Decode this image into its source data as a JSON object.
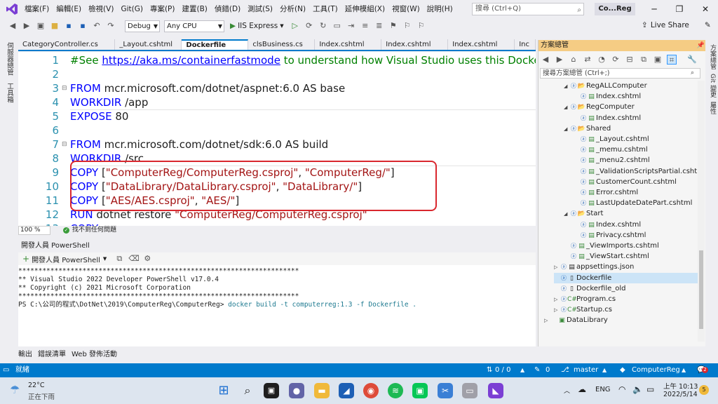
{
  "menubar": {
    "items": [
      "檔案(F)",
      "編輯(E)",
      "檢視(V)",
      "Git(G)",
      "專案(P)",
      "建置(B)",
      "偵錯(D)",
      "測試(S)",
      "分析(N)",
      "工具(T)",
      "延伸模組(X)",
      "視窗(W)",
      "說明(H)"
    ],
    "search_placeholder": "搜尋 (Ctrl+Q)",
    "solution_name": "Co...Reg"
  },
  "toolbar": {
    "config": "Debug",
    "platform": "Any CPU",
    "run_label": "IIS Express",
    "live_share": "Live Share"
  },
  "left_strip": {
    "server_explorer": "伺服器總管",
    "toolbox": "工具箱"
  },
  "doc_tabs": [
    "CategoryController.cs",
    "_Layout.cshtml",
    "Dockerfile",
    "clsBusiness.cs",
    "Index.cshtml",
    "Index.cshtml",
    "Index.cshtml",
    "Inc"
  ],
  "editor": {
    "lines": [
      {
        "n": "1",
        "kw": "",
        "link": "https://aka.ms/containerfastmode",
        "comment_pre": "#See ",
        "comment_post": " to understand how Visual Studio uses this Dockerfile"
      },
      {
        "n": "2"
      },
      {
        "n": "3",
        "kw": "FROM",
        "rest": " mcr.microsoft.com/dotnet/aspnet:6.0 AS base"
      },
      {
        "n": "4",
        "kw": "WORKDIR",
        "rest": " /app"
      },
      {
        "n": "5",
        "kw": "EXPOSE",
        "rest": " 80"
      },
      {
        "n": "6"
      },
      {
        "n": "7",
        "kw": "FROM",
        "rest": " mcr.microsoft.com/dotnet/sdk:6.0 AS build"
      },
      {
        "n": "8",
        "kw": "WORKDIR",
        "rest": " /src"
      },
      {
        "n": "9",
        "kw": "COPY",
        "bracket_open": " [",
        "s1": "\"ComputerReg/ComputerReg.csproj\"",
        "sep": ", ",
        "s2": "\"ComputerReg/\"",
        "bracket_close": "]"
      },
      {
        "n": "10",
        "kw": "COPY",
        "bracket_open": " [",
        "s1": "\"DataLibrary/DataLibrary.csproj\"",
        "sep": ", ",
        "s2": "\"DataLibrary/\"",
        "bracket_close": "]"
      },
      {
        "n": "11",
        "kw": "COPY",
        "bracket_open": " [",
        "s1": "\"AES/AES.csproj\"",
        "sep": ", ",
        "s2": "\"AES/\"",
        "bracket_close": "]"
      },
      {
        "n": "12",
        "kw": "RUN",
        "rest": " dotnet restore ",
        "s1": "\"ComputerReg/ComputerReg.csproj\""
      },
      {
        "n": "13",
        "kw": "COPY",
        "rest": ""
      }
    ],
    "zoom": "100 %",
    "issues": "找不到任何問題"
  },
  "powershell": {
    "title": "開發人員 PowerShell",
    "toolbar_label": "開發人員 PowerShell",
    "stars": "**********************************************************************",
    "line1": "** Visual Studio 2022 Developer PowerShell v17.0.4",
    "line2": "** Copyright (c) 2021 Microsoft Corporation",
    "prompt": "PS C:\\公司的程式\\DotNet\\2019\\ComputerReg\\ComputerReg> ",
    "command": "docker build -t computerreg:1.3 -f Dockerfile ."
  },
  "bottom_tabs": [
    "輸出",
    "錯誤清單",
    "Web 發佈活動"
  ],
  "solution_explorer": {
    "title": "方案總管",
    "search_placeholder": "搜尋方案總管 (Ctrl+;)",
    "nodes": [
      {
        "label": "RegALLComputer",
        "type": "folder",
        "expanded": true,
        "depth": 2
      },
      {
        "label": "Index.cshtml",
        "type": "cshtml",
        "depth": 3
      },
      {
        "label": "RegComputer",
        "type": "folder",
        "expanded": true,
        "depth": 2
      },
      {
        "label": "Index.cshtml",
        "type": "cshtml",
        "depth": 3
      },
      {
        "label": "Shared",
        "type": "folder",
        "expanded": true,
        "depth": 2
      },
      {
        "label": "_Layout.cshtml",
        "type": "cshtml",
        "depth": 3
      },
      {
        "label": "_memu.cshtml",
        "type": "cshtml",
        "depth": 3
      },
      {
        "label": "_menu2.cshtml",
        "type": "cshtml",
        "depth": 3
      },
      {
        "label": "_ValidationScriptsPartial.cshtm",
        "type": "cshtml",
        "depth": 3
      },
      {
        "label": "CustomerCount.cshtml",
        "type": "cshtml",
        "depth": 3
      },
      {
        "label": "Error.cshtml",
        "type": "cshtml",
        "depth": 3
      },
      {
        "label": "LastUpdateDatePart.cshtml",
        "type": "cshtml",
        "depth": 3
      },
      {
        "label": "Start",
        "type": "folder",
        "expanded": true,
        "depth": 2
      },
      {
        "label": "Index.cshtml",
        "type": "cshtml",
        "depth": 3
      },
      {
        "label": "Privacy.cshtml",
        "type": "cshtml",
        "depth": 3
      },
      {
        "label": "_ViewImports.cshtml",
        "type": "cshtml",
        "depth": 2
      },
      {
        "label": "_ViewStart.cshtml",
        "type": "cshtml",
        "depth": 2
      },
      {
        "label": "appsettings.json",
        "type": "json",
        "expanded": false,
        "depth": 1
      },
      {
        "label": "Dockerfile",
        "type": "file",
        "depth": 1,
        "selected": true
      },
      {
        "label": "Dockerfile_old",
        "type": "file",
        "depth": 1
      },
      {
        "label": "Program.cs",
        "type": "cs",
        "expanded": false,
        "depth": 1
      },
      {
        "label": "Startup.cs",
        "type": "cs",
        "expanded": false,
        "depth": 1
      },
      {
        "label": "DataLibrary",
        "type": "project",
        "expanded": false,
        "depth": 0
      }
    ]
  },
  "right_strip": [
    "方案總管",
    "Git 變更",
    "屬性"
  ],
  "statusbar": {
    "ready": "就緒",
    "position": "0 / 0",
    "pending": "0",
    "branch": "master",
    "repo": "ComputerReg",
    "notifications": "2"
  },
  "taskbar": {
    "temperature": "22°C",
    "weather": "正在下雨",
    "lang": "ENG",
    "time": "上午 10:13",
    "date": "2022/5/14",
    "badge": "5"
  },
  "colors": {
    "accent": "#007acc",
    "highlight": "#d9272e",
    "sol_header": "#f5cc84"
  }
}
